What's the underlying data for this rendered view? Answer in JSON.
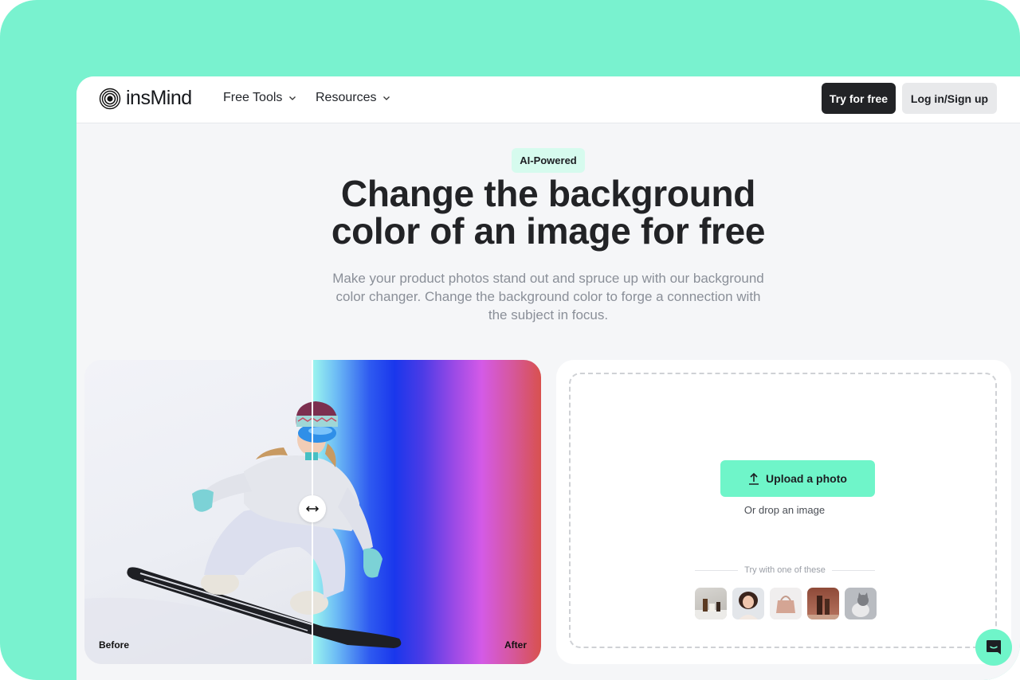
{
  "brand": {
    "name": "insMind",
    "accent": "#6ff5c9",
    "frame_color": "#79f2cf"
  },
  "nav": {
    "items": [
      {
        "label": "Free Tools",
        "icon": "chevron-down-icon"
      },
      {
        "label": "Resources",
        "icon": "chevron-down-icon"
      }
    ],
    "try_label": "Try for free",
    "login_label": "Log in/Sign up"
  },
  "hero": {
    "badge": "AI-Powered",
    "title_line1": "Change the background",
    "title_line2": "color of an image for free",
    "subtitle": "Make your product photos stand out and spruce up with our background color changer. Change the background color to forge a connection with the subject in focus."
  },
  "compare": {
    "before_label": "Before",
    "after_label": "After",
    "handle_icon": "left-right-arrow-icon",
    "split_fraction": 0.5
  },
  "upload": {
    "button_label": "Upload a photo",
    "button_icon": "upload-icon",
    "drop_text": "Or drop an image",
    "try_text": "Try with one of these",
    "samples": [
      {
        "name": "cosmetics-bottles"
      },
      {
        "name": "woman-portrait"
      },
      {
        "name": "pink-handbag"
      },
      {
        "name": "brown-skincare-products"
      },
      {
        "name": "kitten"
      }
    ]
  },
  "chat": {
    "icon": "chat-icon"
  }
}
